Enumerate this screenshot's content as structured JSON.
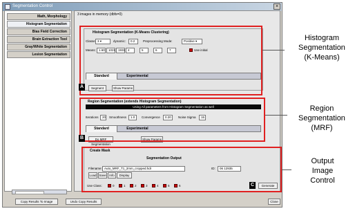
{
  "window": {
    "title": "Segmentation Control",
    "close_glyph": "×"
  },
  "sidebar": {
    "tabs": [
      "Math, Morphology",
      "Histogram Segmentation",
      "Bias Field Correction",
      "Brain Extraction Tool",
      "Gray/White Segmentation",
      "Lesion Segmentation"
    ],
    "active_index": 1
  },
  "main": {
    "images_in_memory": "3 images in memory (dbfs=0)",
    "histogram": {
      "title": "Histogram Segmentation (K-Means Clustering)",
      "classes_label": "Classes:",
      "classes_value": "3",
      "dynamic_label": "dynamic:",
      "dynamic_value": "0.2",
      "preproc_label": "Preprocessing Mode:",
      "preproc_value": "Positive",
      "means_label": "Means:",
      "means_values": [
        "1.60",
        "1021",
        "1931",
        "4",
        "5",
        "6",
        "7"
      ],
      "use_initial_label": "Use initial",
      "tab_standard": "Standard",
      "tab_experimental": "Experimental",
      "segment_button": "Segment",
      "show_params_button": "Show Params"
    },
    "region": {
      "title": "Region Segmentation (extends Histogram Segmentation)",
      "banner": "Using All parameters from Histogram Segmentation as well",
      "iterations_label": "Iterations",
      "iterations_value": "20",
      "smoothness_label": "Smoothness",
      "smoothness_value": "1.0",
      "convergence_label": "Convergence",
      "convergence_value": "0.20",
      "noise_sigma_label": "Noise Sigma",
      "noise_sigma_value": "15",
      "tab_standard": "Standard",
      "tab_experimental": "Experimental",
      "do_mrf_button": "Do MRF Segmentation",
      "show_params_button": "Show Params"
    },
    "mask": {
      "title": "Create Mask",
      "output_title": "Segmentation Output",
      "filename_label": "Filename:",
      "filename_value": "Auto_MRF_T1_2mm_cropped.hdr",
      "id_label": "ID:",
      "id_value": "06 12935",
      "buttons": [
        "Load",
        "Save",
        "Info",
        "Display"
      ],
      "use_class_label": "Use Class:",
      "class_numbers": [
        "0",
        "1",
        "2",
        "3",
        "4",
        "5",
        "6"
      ],
      "generate_button": "Generate"
    }
  },
  "bottom": {
    "copy_results_button": "Copy Results To Image",
    "undo_copy_button": "Undo Copy Results",
    "close_button": "Close"
  },
  "markers": {
    "a": "A",
    "b": "B",
    "c": "C"
  },
  "annotations": {
    "histogram": [
      "Histogram",
      "Segmentation",
      "(K-Means)"
    ],
    "region": [
      "Region",
      "Segmentation",
      "(MRF)"
    ],
    "output": [
      "Output",
      "Image",
      "Control"
    ]
  },
  "colors": {
    "highlight_box": "#e02020",
    "titlebar": "#7f9db9",
    "banner": "#0a0a0a"
  }
}
